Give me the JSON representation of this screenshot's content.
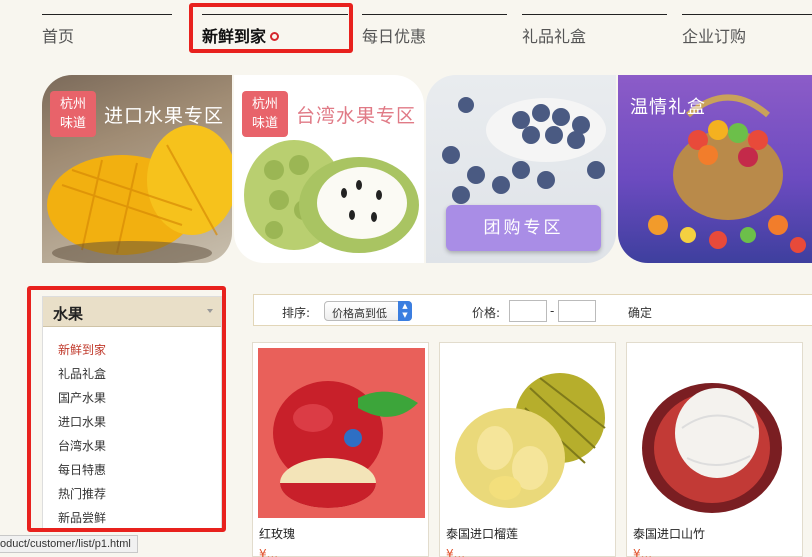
{
  "nav": {
    "items": [
      {
        "label": "首页"
      },
      {
        "label": "新鲜到家"
      },
      {
        "label": "每日优惠"
      },
      {
        "label": "礼品礼盒"
      },
      {
        "label": "企业订购"
      }
    ]
  },
  "banners": {
    "b1": {
      "stamp": "杭州\n味道",
      "title": "进口水果专区"
    },
    "b2": {
      "stamp": "杭州\n味道",
      "title": "台湾水果专区"
    },
    "b3": {
      "button": "团购专区"
    },
    "b4": {
      "title": "温情礼盒"
    }
  },
  "sidebar": {
    "title": "水果",
    "items": [
      {
        "label": "新鲜到家"
      },
      {
        "label": "礼品礼盒"
      },
      {
        "label": "国产水果"
      },
      {
        "label": "进口水果"
      },
      {
        "label": "台湾水果"
      },
      {
        "label": "每日特惠"
      },
      {
        "label": "热门推荐"
      },
      {
        "label": "新品尝鲜"
      }
    ]
  },
  "filter": {
    "sort_label": "排序:",
    "sort_value": "价格高到低",
    "price_label": "价格:",
    "dash": "-",
    "confirm": "确定"
  },
  "products": [
    {
      "name": "红玫瑰",
      "price": "¥..."
    },
    {
      "name": "泰国进口榴莲",
      "price": "¥..."
    },
    {
      "name": "泰国进口山竹",
      "price": "¥..."
    }
  ],
  "status_url": "oduct/customer/list/p1.html",
  "colors": {
    "accent": "#e8211d",
    "price": "#e0502a",
    "sidebar_head": "#e9dfc8"
  }
}
